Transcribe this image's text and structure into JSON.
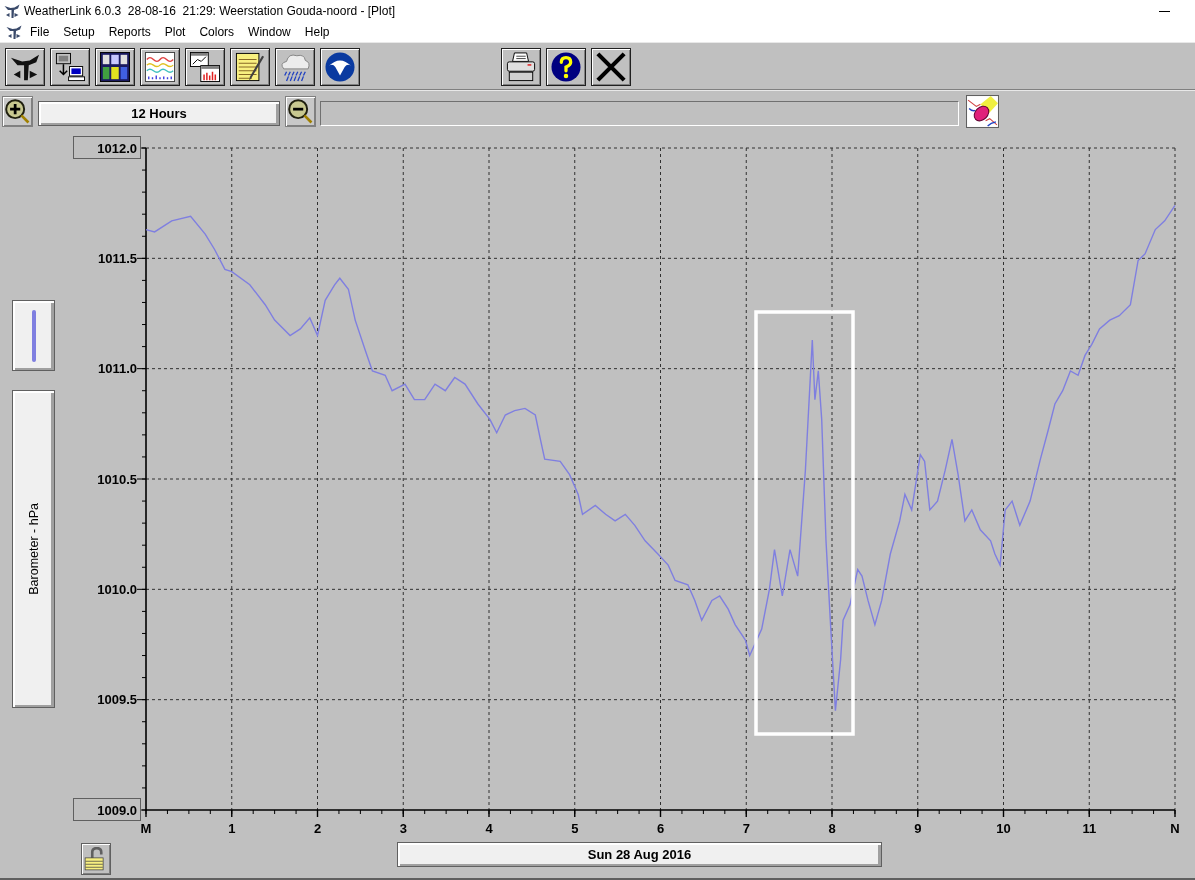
{
  "window": {
    "title": "WeatherLink 6.0.3  28-08-16  21:29: Weerstation Gouda-noord - [Plot]"
  },
  "menu": [
    "File",
    "Setup",
    "Reports",
    "Plot",
    "Colors",
    "Window",
    "Help"
  ],
  "time_span": {
    "label": "12 Hours"
  },
  "plot": {
    "highlight_box": true,
    "chart_data": {
      "type": "line",
      "xlabel": "Sun 28 Aug 2016",
      "ylabel": "Barometer - hPa",
      "x": [
        0,
        0.1,
        0.3,
        0.52,
        0.69,
        0.8,
        0.92,
        1.0,
        1.21,
        1.39,
        1.5,
        1.68,
        1.8,
        1.91,
        2.0,
        2.09,
        2.2,
        2.26,
        2.36,
        2.44,
        2.56,
        2.64,
        2.79,
        2.87,
        3.02,
        3.13,
        3.25,
        3.37,
        3.49,
        3.6,
        3.72,
        3.87,
        4.01,
        4.09,
        4.19,
        4.3,
        4.42,
        4.54,
        4.6,
        4.65,
        4.83,
        4.94,
        5.04,
        5.09,
        5.24,
        5.36,
        5.47,
        5.59,
        5.7,
        5.82,
        5.97,
        6.09,
        6.17,
        6.32,
        6.4,
        6.48,
        6.6,
        6.69,
        6.79,
        6.87,
        6.99,
        7.04,
        7.18,
        7.27,
        7.33,
        7.42,
        7.51,
        7.6,
        7.69,
        7.77,
        7.8,
        7.84,
        7.88,
        7.93,
        7.98,
        8.04,
        8.1,
        8.13,
        8.21,
        8.3,
        8.35,
        8.42,
        8.5,
        8.58,
        8.68,
        8.79,
        8.85,
        8.93,
        9.03,
        9.08,
        9.14,
        9.23,
        9.32,
        9.4,
        9.47,
        9.55,
        9.63,
        9.73,
        9.85,
        9.9,
        9.96,
        10.02,
        10.1,
        10.19,
        10.31,
        10.43,
        10.52,
        10.6,
        10.69,
        10.78,
        10.87,
        10.95,
        11.03,
        11.12,
        11.24,
        11.35,
        11.48,
        11.57,
        11.65,
        11.77,
        11.88,
        12.0
      ],
      "series": [
        {
          "color": "#7f7fe0",
          "values": [
            1011.63,
            1011.62,
            1011.67,
            1011.69,
            1011.61,
            1011.54,
            1011.45,
            1011.44,
            1011.38,
            1011.29,
            1011.22,
            1011.15,
            1011.18,
            1011.23,
            1011.15,
            1011.31,
            1011.38,
            1011.41,
            1011.36,
            1011.22,
            1011.08,
            1010.99,
            1010.97,
            1010.9,
            1010.93,
            1010.86,
            1010.86,
            1010.93,
            1010.9,
            1010.96,
            1010.93,
            1010.84,
            1010.77,
            1010.71,
            1010.79,
            1010.81,
            1010.82,
            1010.79,
            1010.68,
            1010.59,
            1010.58,
            1010.52,
            1010.43,
            1010.34,
            1010.38,
            1010.34,
            1010.31,
            1010.34,
            1010.29,
            1010.22,
            1010.16,
            1010.11,
            1010.04,
            1010.02,
            1009.95,
            1009.86,
            1009.95,
            1009.97,
            1009.91,
            1009.84,
            1009.77,
            1009.7,
            1009.82,
            1010.0,
            1010.18,
            1009.97,
            1010.18,
            1010.06,
            1010.54,
            1011.13,
            1010.86,
            1010.99,
            1010.77,
            1010.22,
            1009.86,
            1009.45,
            1009.68,
            1009.86,
            1009.93,
            1010.09,
            1010.06,
            1009.95,
            1009.84,
            1009.95,
            1010.16,
            1010.31,
            1010.43,
            1010.36,
            1010.61,
            1010.58,
            1010.36,
            1010.4,
            1010.54,
            1010.68,
            1010.52,
            1010.31,
            1010.36,
            1010.27,
            1010.22,
            1010.16,
            1010.11,
            1010.36,
            1010.4,
            1010.29,
            1010.4,
            1010.59,
            1010.72,
            1010.84,
            1010.9,
            1010.99,
            1010.97,
            1011.06,
            1011.11,
            1011.18,
            1011.22,
            1011.24,
            1011.29,
            1011.49,
            1011.52,
            1011.63,
            1011.67,
            1011.74
          ]
        }
      ],
      "xlim": [
        0,
        12
      ],
      "ylim": [
        1009,
        1012
      ],
      "xticks": [
        {
          "value": 0,
          "label": "M"
        },
        {
          "value": 1,
          "label": "1"
        },
        {
          "value": 2,
          "label": "2"
        },
        {
          "value": 3,
          "label": "3"
        },
        {
          "value": 4,
          "label": "4"
        },
        {
          "value": 5,
          "label": "5"
        },
        {
          "value": 6,
          "label": "6"
        },
        {
          "value": 7,
          "label": "7"
        },
        {
          "value": 8,
          "label": "8"
        },
        {
          "value": 9,
          "label": "9"
        },
        {
          "value": 10,
          "label": "10"
        },
        {
          "value": 11,
          "label": "11"
        },
        {
          "value": 12,
          "label": "N"
        }
      ],
      "yticks": [
        {
          "value": 1009,
          "label": "1009.0"
        },
        {
          "value": 1009.5,
          "label": "1009.5"
        },
        {
          "value": 1010,
          "label": "1010.0"
        },
        {
          "value": 1010.5,
          "label": "1010.5"
        },
        {
          "value": 1011,
          "label": "1011.0"
        },
        {
          "value": 1011.5,
          "label": "1011.5"
        },
        {
          "value": 1012,
          "label": "1012.0"
        }
      ],
      "grid": true
    }
  }
}
